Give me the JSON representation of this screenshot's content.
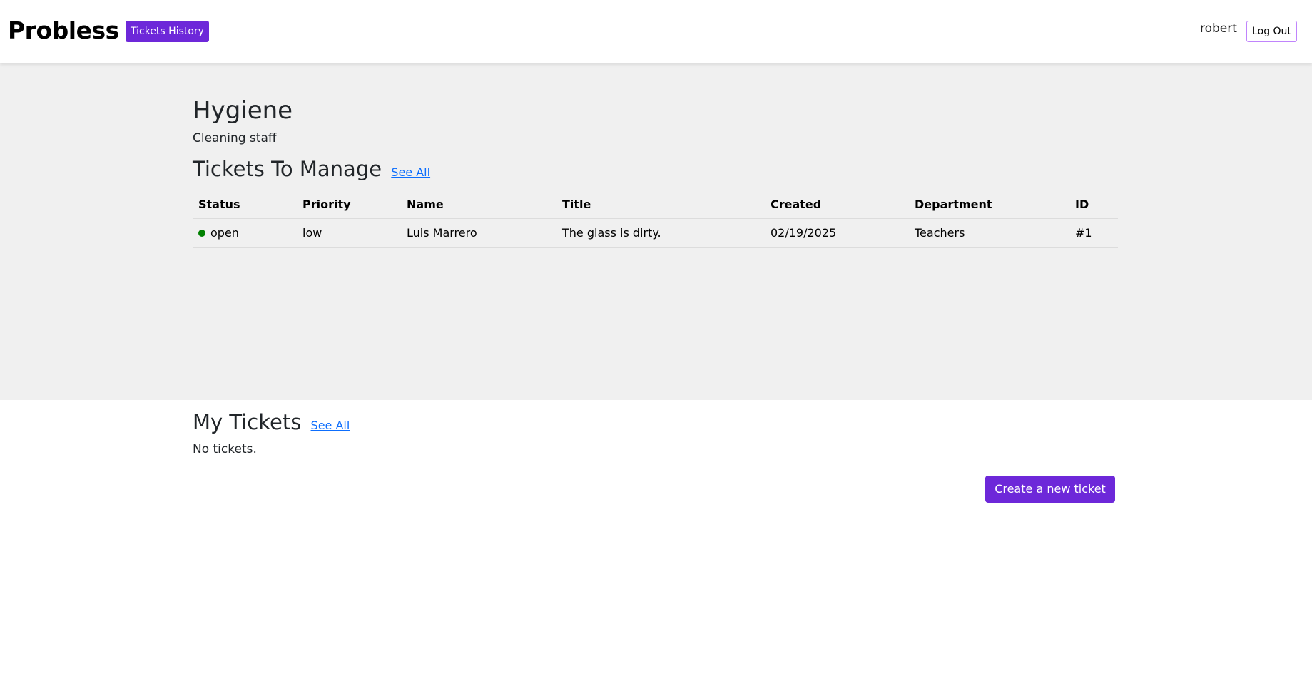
{
  "header": {
    "brand": "Probless",
    "history_button": "Tickets History",
    "username": "robert",
    "logout_button": "Log Out"
  },
  "department": {
    "name": "Hygiene",
    "role": "Cleaning staff"
  },
  "manage": {
    "heading": "Tickets To Manage",
    "see_all": "See All",
    "columns": [
      "Status",
      "Priority",
      "Name",
      "Title",
      "Created",
      "Department",
      "ID"
    ],
    "rows": [
      {
        "status": "open",
        "status_color": "#008000",
        "priority": "low",
        "name": "Luis Marrero",
        "title": "The glass is dirty.",
        "created": "02/19/2025",
        "department": "Teachers",
        "id": "#1"
      }
    ]
  },
  "my_tickets": {
    "heading": "My Tickets",
    "see_all": "See All",
    "empty_text": "No tickets.",
    "create_button": "Create a new ticket"
  },
  "colors": {
    "accent": "#6d28d9",
    "link": "#0d6efd",
    "section_bg": "#f0f0f0"
  }
}
